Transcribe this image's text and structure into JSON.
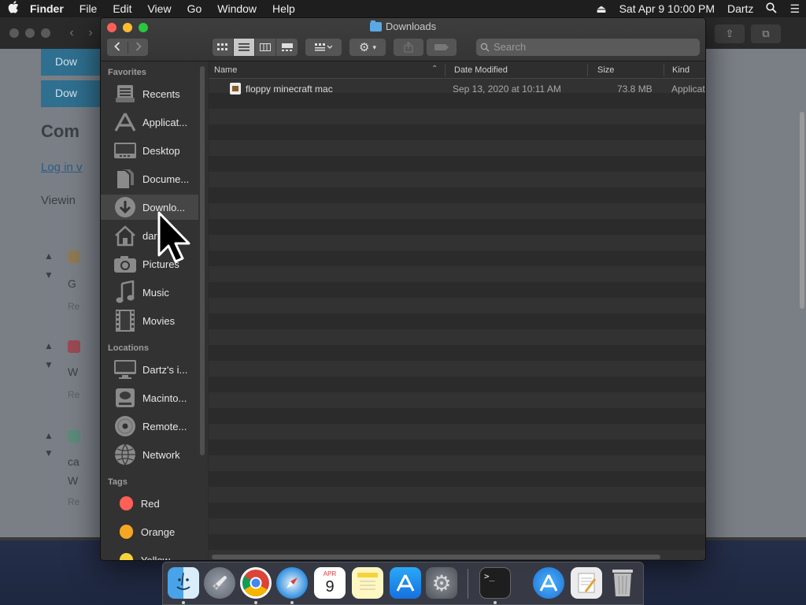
{
  "menubar": {
    "apple": "",
    "app_name": "Finder",
    "items": [
      "File",
      "Edit",
      "View",
      "Go",
      "Window",
      "Help"
    ],
    "datetime": "Sat Apr 9  10:00 PM",
    "user": "Dartz"
  },
  "background_page": {
    "download_label_1": "Dow",
    "download_label_2": "Dow",
    "heading": "Com",
    "login_link": "Log in v",
    "viewing_text": "Viewin",
    "snippets": [
      "G",
      "Re",
      "W",
      "Re",
      "ca",
      "W",
      "Re"
    ]
  },
  "finder": {
    "title": "Downloads",
    "search_placeholder": "Search",
    "sidebar": {
      "favorites_heading": "Favorites",
      "favorites": [
        {
          "label": "Recents",
          "icon": "recents-icon"
        },
        {
          "label": "Applicat...",
          "icon": "applications-icon"
        },
        {
          "label": "Desktop",
          "icon": "desktop-icon"
        },
        {
          "label": "Docume...",
          "icon": "documents-icon"
        },
        {
          "label": "Downlo...",
          "icon": "downloads-icon"
        },
        {
          "label": "dar",
          "icon": "home-icon"
        },
        {
          "label": "Pictures",
          "icon": "pictures-icon"
        },
        {
          "label": "Music",
          "icon": "music-icon"
        },
        {
          "label": "Movies",
          "icon": "movies-icon"
        }
      ],
      "locations_heading": "Locations",
      "locations": [
        {
          "label": "Dartz's i...",
          "icon": "computer-icon"
        },
        {
          "label": "Macinto...",
          "icon": "disk-icon"
        },
        {
          "label": "Remote...",
          "icon": "remote-disc-icon"
        },
        {
          "label": "Network",
          "icon": "network-icon"
        }
      ],
      "tags_heading": "Tags",
      "tags": [
        {
          "label": "Red",
          "color": "#ff5f57"
        },
        {
          "label": "Orange",
          "color": "#f5a623"
        },
        {
          "label": "Yellow",
          "color": "#f7d33b"
        }
      ]
    },
    "columns": {
      "name": "Name",
      "date_modified": "Date Modified",
      "size": "Size",
      "kind": "Kind"
    },
    "files": [
      {
        "name": "floppy minecraft mac",
        "date_modified": "Sep 13, 2020 at 10:11 AM",
        "size": "73.8 MB",
        "kind": "Applicat"
      }
    ]
  },
  "dock": {
    "apps": [
      "finder-icon",
      "launchpad-icon",
      "chrome-icon",
      "safari-icon",
      "calendar-icon",
      "notes-icon",
      "app-store-icon",
      "system-preferences-icon",
      "terminal-icon",
      "applications-folder-icon",
      "textedit-icon",
      "trash-icon"
    ],
    "calendar": {
      "month": "APR",
      "day": "9"
    }
  }
}
